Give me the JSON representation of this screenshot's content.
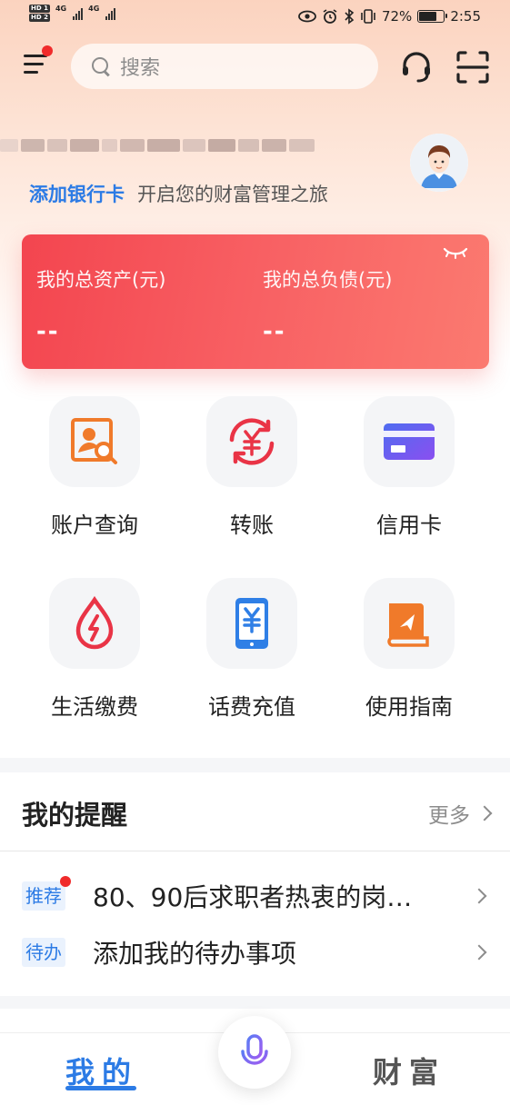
{
  "status_bar": {
    "battery": "72%",
    "time": "2:55",
    "network": "4G"
  },
  "header": {
    "search_placeholder": "搜索"
  },
  "profile": {
    "add_card_link": "添加银行卡",
    "add_card_tip": "开启您的财富管理之旅"
  },
  "assets": {
    "total_assets_label": "我的总资产(元)",
    "total_assets_value": "--",
    "total_debt_label": "我的总负债(元)",
    "total_debt_value": "--"
  },
  "services": [
    {
      "label": "账户查询",
      "icon": "account-search-icon"
    },
    {
      "label": "转账",
      "icon": "transfer-icon"
    },
    {
      "label": "信用卡",
      "icon": "credit-card-icon"
    },
    {
      "label": "生活缴费",
      "icon": "utility-payment-icon"
    },
    {
      "label": "话费充值",
      "icon": "phone-recharge-icon"
    },
    {
      "label": "使用指南",
      "icon": "user-guide-icon"
    }
  ],
  "reminders": {
    "title": "我的提醒",
    "more": "更多",
    "items": [
      {
        "tag": "推荐",
        "text": "80、90后求职者热衷的岗…"
      },
      {
        "tag": "待办",
        "text": "添加我的待办事项"
      }
    ]
  },
  "tabbar": {
    "mine": "我的",
    "wealth": "财富"
  },
  "colors": {
    "accent": "#2c7be5",
    "card_red": "#f3454f",
    "notification_red": "#f02b2b"
  }
}
